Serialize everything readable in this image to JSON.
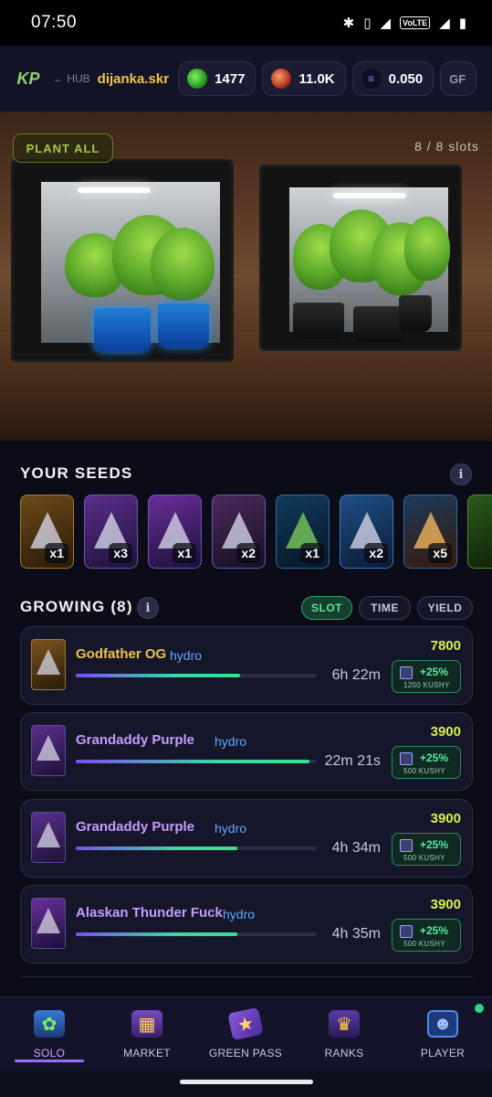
{
  "status_bar": {
    "time": "07:50",
    "network_badge": "VoLTE"
  },
  "header": {
    "logo_text": "KP",
    "hub_label": "← HUB",
    "username": "dijanka.skr",
    "chips": [
      {
        "icon": "green-coin-icon",
        "value": "1477"
      },
      {
        "icon": "red-coin-icon",
        "value": "11.0K"
      },
      {
        "icon": "solana-icon",
        "value": "0.050"
      },
      {
        "icon": "",
        "value": "GF"
      }
    ]
  },
  "hero": {
    "plant_all_label": "PLANT ALL",
    "slots_text": "8 / 8 slots"
  },
  "seeds": {
    "title": "YOUR SEEDS",
    "info": "i",
    "items": [
      {
        "count": "x1",
        "theme": "gold"
      },
      {
        "count": "x3",
        "theme": "purple"
      },
      {
        "count": "x1",
        "theme": "purple"
      },
      {
        "count": "x2",
        "theme": "purple"
      },
      {
        "count": "x1",
        "theme": "blue"
      },
      {
        "count": "x2",
        "theme": "blue"
      },
      {
        "count": "x5",
        "theme": "fire"
      }
    ]
  },
  "growing": {
    "title": "GROWING (8)",
    "info": "i",
    "sort": {
      "slot": "SLOT",
      "time": "TIME",
      "yield": "YIELD"
    },
    "items": [
      {
        "name": "Godfather OG",
        "method": "hydro",
        "time_left": "6h 22m",
        "reward": "7800",
        "boost_pct": "+25%",
        "boost_cost": "1200 KUSHY",
        "progress": 0.68,
        "theme": "gold"
      },
      {
        "name": "Grandaddy Purple",
        "method": "hydro",
        "time_left": "22m 21s",
        "reward": "3900",
        "boost_pct": "+25%",
        "boost_cost": "500 KUSHY",
        "progress": 0.97,
        "theme": "purple"
      },
      {
        "name": "Grandaddy Purple",
        "method": "hydro",
        "time_left": "4h 34m",
        "reward": "3900",
        "boost_pct": "+25%",
        "boost_cost": "500 KUSHY",
        "progress": 0.67,
        "theme": "purple"
      },
      {
        "name": "Alaskan Thunder Fuck",
        "method": "hydro",
        "time_left": "4h 35m",
        "reward": "3900",
        "boost_pct": "+25%",
        "boost_cost": "500 KUSHY",
        "progress": 0.67,
        "theme": "purple"
      }
    ]
  },
  "nav": {
    "items": [
      {
        "label": "SOLO",
        "icon": "sprout-box-icon"
      },
      {
        "label": "MARKET",
        "icon": "market-stall-icon"
      },
      {
        "label": "GREEN PASS",
        "icon": "ticket-icon"
      },
      {
        "label": "RANKS",
        "icon": "trophy-icon"
      },
      {
        "label": "PLAYER",
        "icon": "player-profile-icon"
      }
    ]
  },
  "colors": {
    "background": "#0b0c18",
    "accent_gold": "#f0c24a",
    "accent_green": "#57e39a",
    "accent_purple": "#9b6cff",
    "hydro_blue": "#62a7ff",
    "reward_yellow": "#d8f04a"
  }
}
